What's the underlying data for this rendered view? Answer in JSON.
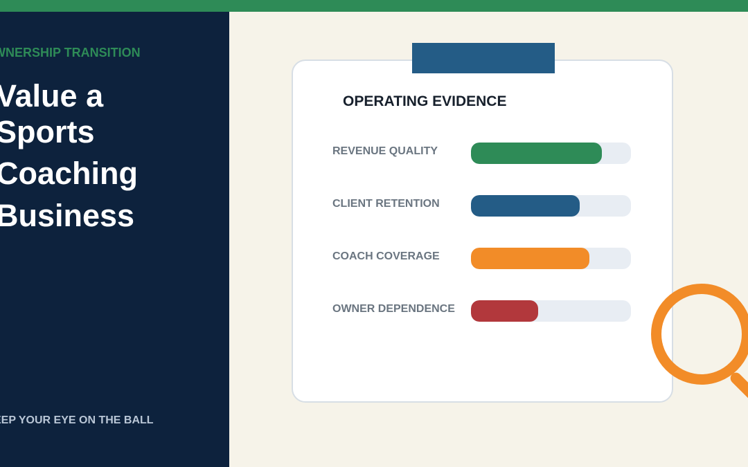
{
  "header": {
    "eyebrow": "WNERSHIP TRANSITION",
    "title_lines": [
      "Value a",
      "Sports",
      "Coaching",
      "Business"
    ],
    "tagline": "EEP YOUR EYE ON THE BALL"
  },
  "card": {
    "title": "OPERATING EVIDENCE",
    "metrics": [
      {
        "label": "REVENUE QUALITY",
        "level": 0.82,
        "color": "#2e8b57"
      },
      {
        "label": "CLIENT RETENTION",
        "level": 0.68,
        "color": "#245c86"
      },
      {
        "label": "COACH COVERAGE",
        "level": 0.74,
        "color": "#f28c28"
      },
      {
        "label": "OWNER DEPENDENCE",
        "level": 0.42,
        "color": "#b2383c"
      }
    ]
  },
  "decorations": {
    "magnifier": "magnifying-glass-icon"
  },
  "colors": {
    "accent_green": "#2e8b57",
    "panel_navy": "#0d223d",
    "tab_blue": "#245c86",
    "magnifier_orange": "#f28c28",
    "background": "#f6f3e9"
  }
}
